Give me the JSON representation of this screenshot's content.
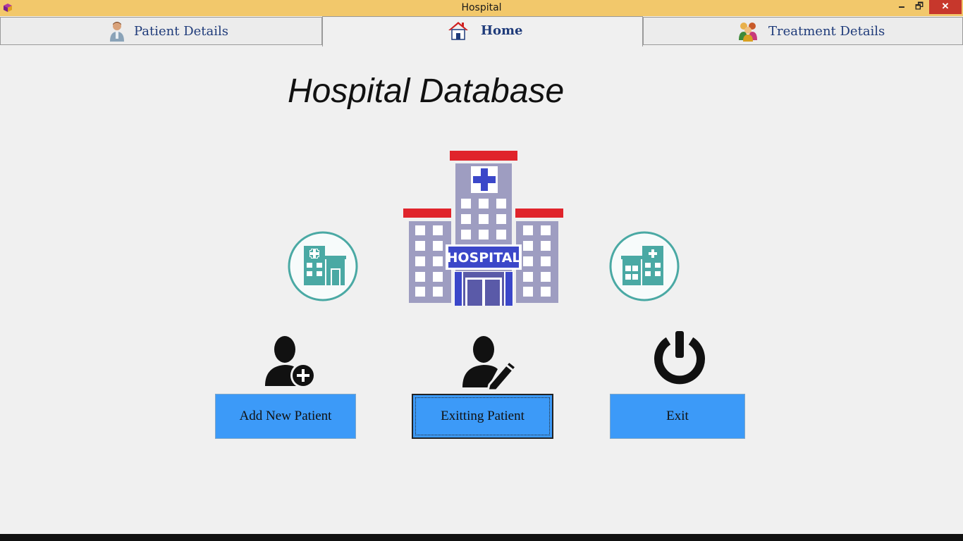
{
  "window": {
    "title": "Hospital",
    "minimize_glyph": "🗕",
    "restore_glyph": "🗗",
    "close_glyph": "✕"
  },
  "tabs": [
    {
      "label": "Patient Details",
      "icon": "patient-person-icon",
      "active": false
    },
    {
      "label": "Home",
      "icon": "house-icon",
      "active": true
    },
    {
      "label": "Treatment Details",
      "icon": "people-group-icon",
      "active": false
    }
  ],
  "main": {
    "title": "Hospital Database",
    "hospital_sign": "HOSPITAL",
    "left_icon": "clinic-building-icon",
    "right_icon": "clinic-building-icon"
  },
  "actions": [
    {
      "label": "Add New Patient",
      "icon": "add-user-icon"
    },
    {
      "label": "Exitting Patient",
      "icon": "edit-user-icon"
    },
    {
      "label": "Exit",
      "icon": "power-icon"
    }
  ],
  "colors": {
    "titlebar": "#f2c86b",
    "button": "#3c9af8",
    "teal": "#4aa9a4",
    "hospital_red": "#e0242b",
    "hospital_blue": "#3b47c9",
    "hospital_grey": "#9e9dc1"
  }
}
